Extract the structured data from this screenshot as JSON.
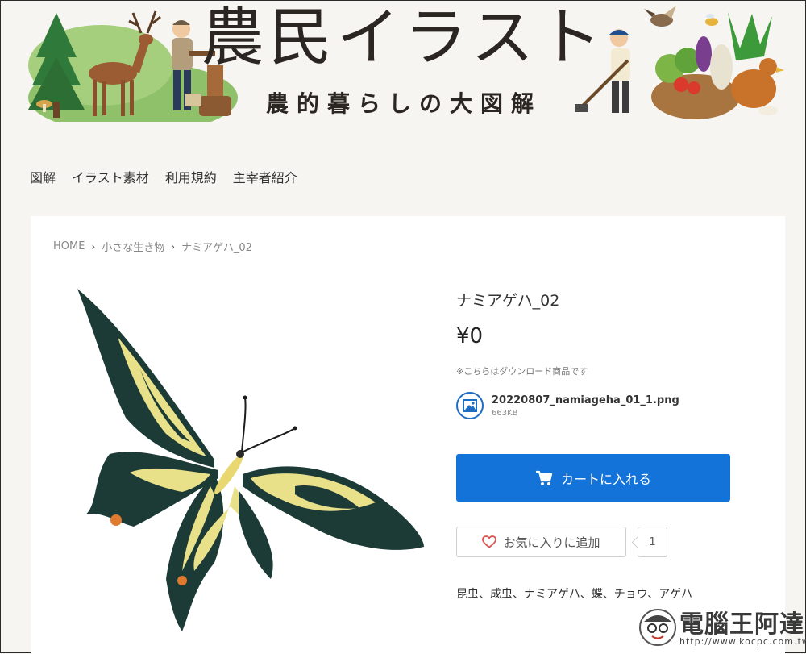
{
  "header": {
    "title": "農民イラスト",
    "subtitle": "農的暮らしの大図解"
  },
  "nav": {
    "items": [
      {
        "label": "図解"
      },
      {
        "label": "イラスト素材"
      },
      {
        "label": "利用規約"
      },
      {
        "label": "主宰者紹介"
      }
    ]
  },
  "breadcrumb": {
    "home": "HOME",
    "category": "小さな生き物",
    "current": "ナミアゲハ_02"
  },
  "product": {
    "title": "ナミアゲハ_02",
    "price": "¥0",
    "note": "※こちらはダウンロード商品です",
    "file_name": "20220807_namiageha_01_1.png",
    "file_size": "663KB",
    "cart_label": "カートに入れる",
    "favorite_label": "お気に入りに追加",
    "favorite_count": "1",
    "tags": "昆虫、成虫、ナミアゲハ、蝶、チョウ、アゲハ"
  },
  "watermark": {
    "title": "電腦王阿達",
    "url": "http://www.kocpc.com.tw"
  },
  "colors": {
    "accent": "#1473d8",
    "background": "#f6f5f2",
    "heart": "#d9534f"
  }
}
